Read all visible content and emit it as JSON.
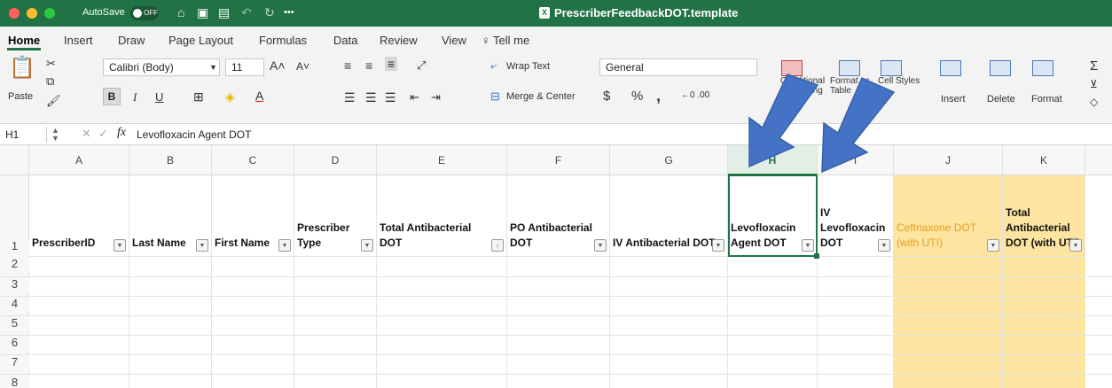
{
  "titlebar": {
    "autosave_label": "AutoSave",
    "toggle": "OFF",
    "doc_title": "PrescriberFeedbackDOT.template",
    "bg": "#217346"
  },
  "tabs": [
    "Home",
    "Insert",
    "Draw",
    "Page Layout",
    "Formulas",
    "Data",
    "Review",
    "View",
    "Tell me"
  ],
  "ribbon": {
    "paste": "Paste",
    "font_name": "Calibri (Body)",
    "font_size": "11",
    "bold": "B",
    "italic": "I",
    "underline": "U",
    "wrap_text": "Wrap Text",
    "merge_center": "Merge & Center",
    "number_format": "General",
    "currency": "$",
    "percent": "%",
    "comma": ",",
    "cond_format": "Conditional Formatting",
    "format_table": "Format as Table",
    "cell_styles": "Cell Styles",
    "insert": "Insert",
    "delete": "Delete",
    "format": "Format"
  },
  "formula_bar": {
    "name_box": "H1",
    "fx": "fx",
    "value": "Levofloxacin Agent DOT"
  },
  "columns": [
    "A",
    "B",
    "C",
    "D",
    "E",
    "F",
    "G",
    "H",
    "I",
    "J",
    "K"
  ],
  "rows": [
    "1",
    "2",
    "3",
    "4",
    "5",
    "6",
    "7",
    "8"
  ],
  "headers": [
    "PrescriberID",
    "Last Name",
    "First Name",
    "Prescriber Type",
    "Total Antibacterial DOT",
    "PO Antibacterial DOT",
    "IV Antibacterial DOT",
    "Levofloxacin Agent DOT",
    "IV Levofloxacin DOT",
    "Ceftriaxone DOT (with UTI)",
    "Total Antibacterial DOT (with UTI)"
  ],
  "colors": {
    "excel_green": "#217346",
    "arrow": "#4472c4",
    "highlight": "#fde4a0",
    "orange_text": "#e6a020"
  }
}
